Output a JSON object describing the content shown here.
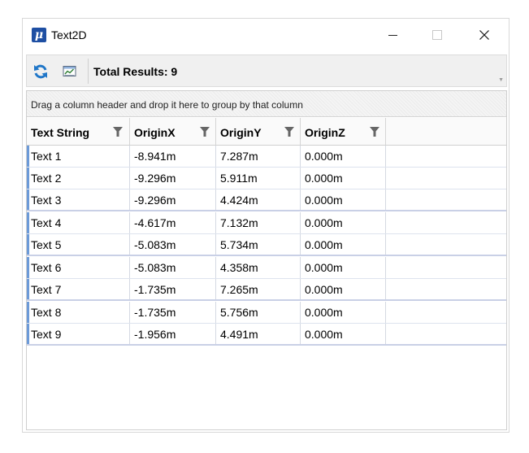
{
  "window": {
    "title": "Text2D",
    "app_icon": "microstation-icon"
  },
  "toolbar": {
    "total_results": "Total Results: 9",
    "refresh_icon": "refresh-icon",
    "export_icon": "export-to-excel-icon"
  },
  "grid": {
    "group_panel_text": "Drag a column header and drop it here to group by that column",
    "columns": [
      "Text String",
      "OriginX",
      "OriginY",
      "OriginZ"
    ],
    "rows": [
      [
        "Text 1",
        "-8.941m",
        "7.287m",
        "0.000m"
      ],
      [
        "Text 2",
        "-9.296m",
        "5.911m",
        "0.000m"
      ],
      [
        "Text 3",
        "-9.296m",
        "4.424m",
        "0.000m"
      ],
      [
        "Text 4",
        "-4.617m",
        "7.132m",
        "0.000m"
      ],
      [
        "Text 5",
        "-5.083m",
        "5.734m",
        "0.000m"
      ],
      [
        "Text 6",
        "-5.083m",
        "4.358m",
        "0.000m"
      ],
      [
        "Text 7",
        "-1.735m",
        "7.265m",
        "0.000m"
      ],
      [
        "Text 8",
        "-1.735m",
        "5.756m",
        "0.000m"
      ],
      [
        "Text 9",
        "-1.956m",
        "4.491m",
        "0.000m"
      ]
    ]
  },
  "colors": {
    "accent": "#1e4fa3",
    "refresh": "#1f76c8",
    "row_marker": "#6c9ad8"
  }
}
